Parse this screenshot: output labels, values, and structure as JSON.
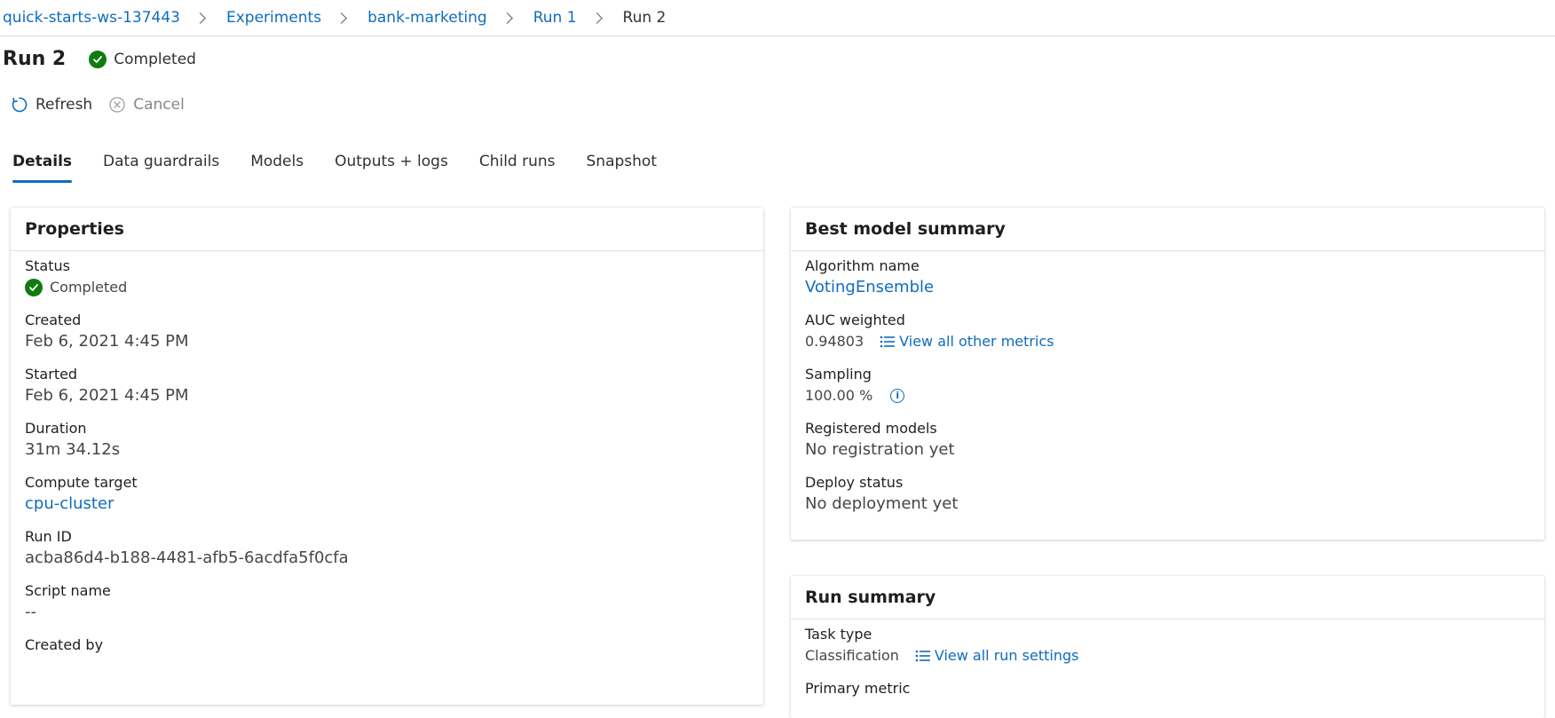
{
  "breadcrumb": {
    "items": [
      "quick-starts-ws-137443",
      "Experiments",
      "bank-marketing",
      "Run 1",
      "Run 2"
    ]
  },
  "header": {
    "title": "Run 2",
    "status": "Completed"
  },
  "toolbar": {
    "refresh_label": "Refresh",
    "cancel_label": "Cancel"
  },
  "tabs": [
    {
      "label": "Details"
    },
    {
      "label": "Data guardrails"
    },
    {
      "label": "Models"
    },
    {
      "label": "Outputs + logs"
    },
    {
      "label": "Child runs"
    },
    {
      "label": "Snapshot"
    }
  ],
  "properties": {
    "title": "Properties",
    "status_label": "Status",
    "status_value": "Completed",
    "created_label": "Created",
    "created_value": "Feb 6, 2021 4:45 PM",
    "started_label": "Started",
    "started_value": "Feb 6, 2021 4:45 PM",
    "duration_label": "Duration",
    "duration_value": "31m 34.12s",
    "compute_label": "Compute target",
    "compute_value": "cpu-cluster",
    "runid_label": "Run ID",
    "runid_value": "acba86d4-b188-4481-afb5-6acdfa5f0cfa",
    "script_label": "Script name",
    "script_value": "--",
    "createdby_label": "Created by"
  },
  "best_model": {
    "title": "Best model summary",
    "algo_label": "Algorithm name",
    "algo_value": "VotingEnsemble",
    "auc_label": "AUC weighted",
    "auc_value": "0.94803",
    "metrics_link": "View all other metrics",
    "sampling_label": "Sampling",
    "sampling_value": "100.00 %",
    "registered_label": "Registered models",
    "registered_value": "No registration yet",
    "deploy_label": "Deploy status",
    "deploy_value": "No deployment yet"
  },
  "run_summary": {
    "title": "Run summary",
    "task_label": "Task type",
    "task_value": "Classification",
    "settings_link": "View all run settings",
    "primary_metric_label": "Primary metric"
  },
  "colors": {
    "accent": "#0f6cbd",
    "success": "#107c10"
  }
}
